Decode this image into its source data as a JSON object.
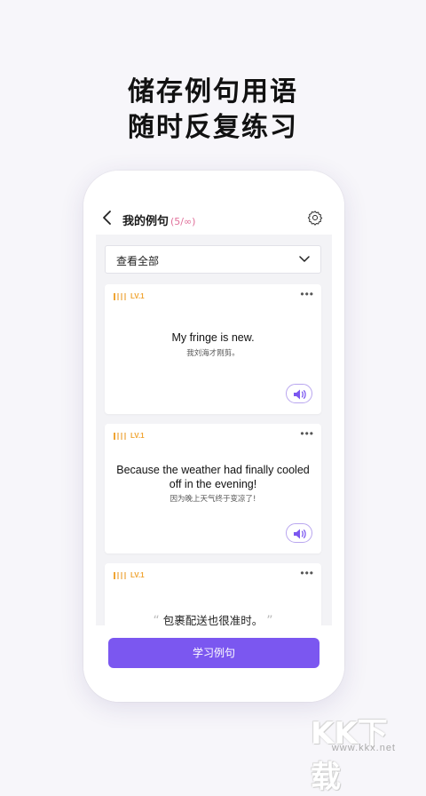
{
  "promo": {
    "line1": "储存例句用语",
    "line2": "随时反复练习"
  },
  "header": {
    "title": "我的例句",
    "count": "(5/∞)"
  },
  "filter": {
    "selected": "查看全部"
  },
  "cards": [
    {
      "level": "LV.1",
      "more": "•••",
      "en": "My fringe is new.",
      "zh": "我刘海才刚剪。"
    },
    {
      "level": "LV.1",
      "more": "•••",
      "en": "Because the weather had finally cooled off in the evening!",
      "zh": "因为晚上天气终于变凉了!"
    },
    {
      "level": "LV.1",
      "more": "•••",
      "open_quote": "“",
      "quote": "包裹配送也很准时。",
      "close_quote": "”"
    }
  ],
  "bottom": {
    "study_label": "学习例句"
  },
  "watermark": {
    "main": "KK下载",
    "sub": "www.kkx.net"
  },
  "colors": {
    "accent": "#7b57f0",
    "level": "#f0a534",
    "count": "#e0709a"
  }
}
